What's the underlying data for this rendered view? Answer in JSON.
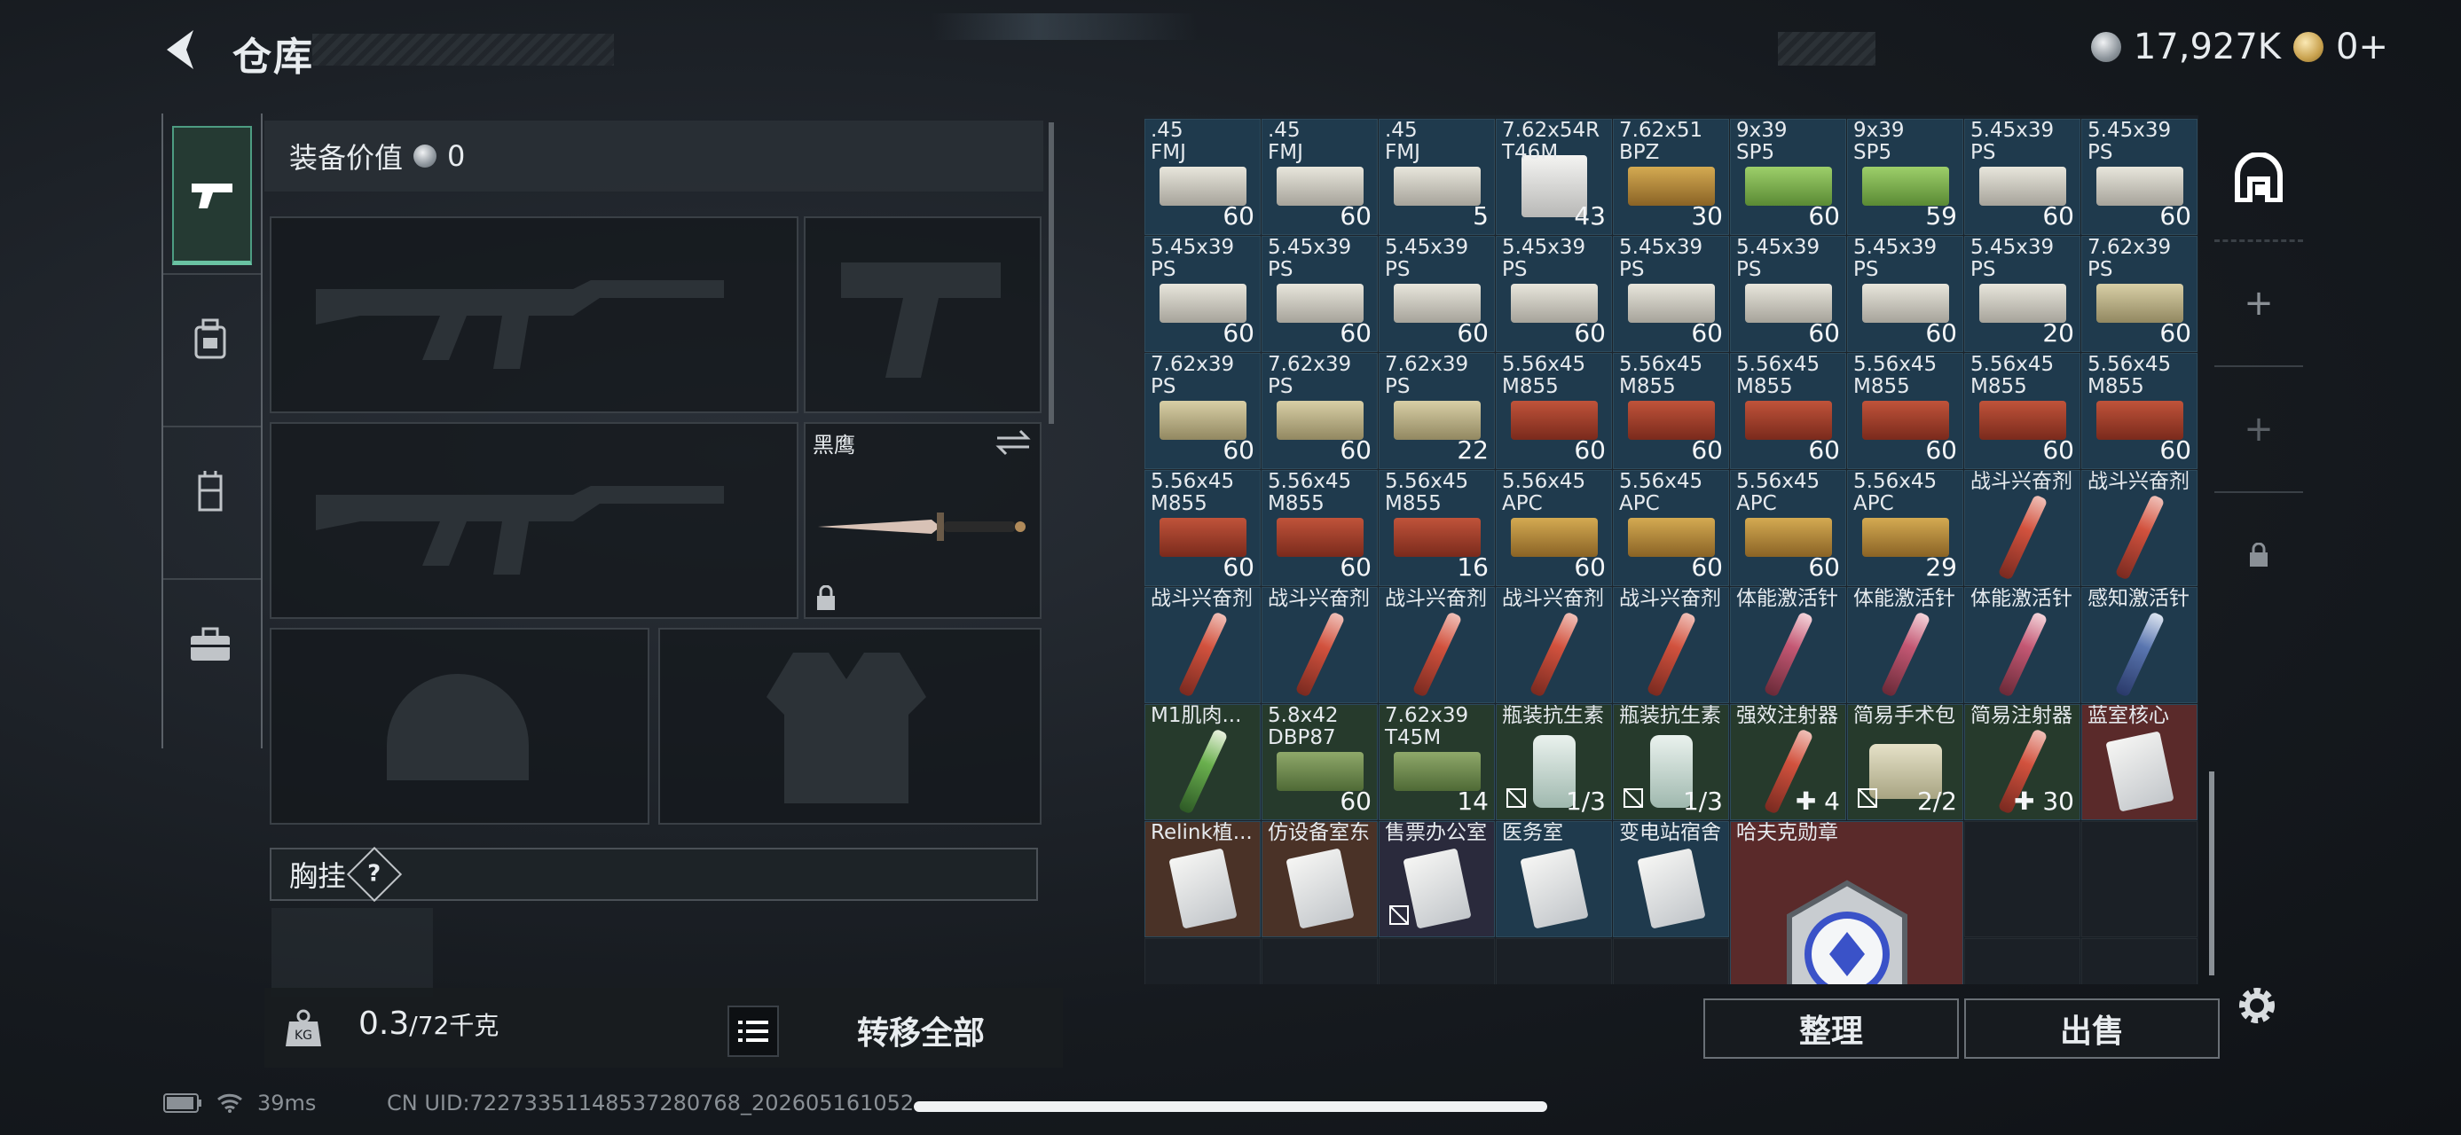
{
  "header": {
    "title": "仓库",
    "currency_silver": "17,927K",
    "currency_gold": "0+"
  },
  "equipment": {
    "value_label": "装备价值",
    "value": "0",
    "secondary_slot_label": "黑鹰",
    "chest_label": "胸挂",
    "weight_current": "0.3",
    "weight_max": "/72千克",
    "transfer_all": "转移全部"
  },
  "stash": {
    "rows": [
      [
        {
          "n": ".45\nFMJ",
          "q": "60",
          "a": "silver"
        },
        {
          "n": ".45\nFMJ",
          "q": "60",
          "a": "silver"
        },
        {
          "n": ".45\nFMJ",
          "q": "5",
          "a": "silver"
        },
        {
          "n": "7.62x54R\nT46M",
          "q": "43",
          "a": "white"
        },
        {
          "n": "7.62x51\nBPZ",
          "q": "30",
          "a": "gold"
        },
        {
          "n": "9x39\nSP5",
          "q": "60",
          "a": "grn"
        },
        {
          "n": "9x39\nSP5",
          "q": "59",
          "a": "grn"
        },
        {
          "n": "5.45x39\nPS",
          "q": "60",
          "a": "silver"
        },
        {
          "n": "5.45x39\nPS",
          "q": "60",
          "a": "silver"
        }
      ],
      [
        {
          "n": "5.45x39\nPS",
          "q": "60",
          "a": "silver"
        },
        {
          "n": "5.45x39\nPS",
          "q": "60",
          "a": "silver"
        },
        {
          "n": "5.45x39\nPS",
          "q": "60",
          "a": "silver"
        },
        {
          "n": "5.45x39\nPS",
          "q": "60",
          "a": "silver"
        },
        {
          "n": "5.45x39\nPS",
          "q": "60",
          "a": "silver"
        },
        {
          "n": "5.45x39\nPS",
          "q": "60",
          "a": "silver"
        },
        {
          "n": "5.45x39\nPS",
          "q": "60",
          "a": "silver"
        },
        {
          "n": "5.45x39\nPS",
          "q": "20",
          "a": "silver"
        },
        {
          "n": "7.62x39\nPS",
          "q": "60",
          "a": "tan"
        }
      ],
      [
        {
          "n": "7.62x39\nPS",
          "q": "60",
          "a": "tan"
        },
        {
          "n": "7.62x39\nPS",
          "q": "60",
          "a": "tan"
        },
        {
          "n": "7.62x39\nPS",
          "q": "22",
          "a": "tan"
        },
        {
          "n": "5.56x45\nM855",
          "q": "60",
          "a": "redb"
        },
        {
          "n": "5.56x45\nM855",
          "q": "60",
          "a": "redb"
        },
        {
          "n": "5.56x45\nM855",
          "q": "60",
          "a": "redb"
        },
        {
          "n": "5.56x45\nM855",
          "q": "60",
          "a": "redb"
        },
        {
          "n": "5.56x45\nM855",
          "q": "60",
          "a": "redb"
        },
        {
          "n": "5.56x45\nM855",
          "q": "60",
          "a": "redb"
        }
      ],
      [
        {
          "n": "5.56x45\nM855",
          "q": "60",
          "a": "redb"
        },
        {
          "n": "5.56x45\nM855",
          "q": "60",
          "a": "redb"
        },
        {
          "n": "5.56x45\nM855",
          "q": "16",
          "a": "redb"
        },
        {
          "n": "5.56x45\nAPC",
          "q": "60",
          "a": "gold"
        },
        {
          "n": "5.56x45\nAPC",
          "q": "60",
          "a": "gold"
        },
        {
          "n": "5.56x45\nAPC",
          "q": "60",
          "a": "gold"
        },
        {
          "n": "5.56x45\nAPC",
          "q": "29",
          "a": "gold"
        },
        {
          "n": "战斗兴奋剂",
          "q": "",
          "a": "syr-red"
        },
        {
          "n": "战斗兴奋剂",
          "q": "",
          "a": "syr-red"
        }
      ],
      [
        {
          "n": "战斗兴奋剂",
          "q": "",
          "a": "syr-red"
        },
        {
          "n": "战斗兴奋剂",
          "q": "",
          "a": "syr-red"
        },
        {
          "n": "战斗兴奋剂",
          "q": "",
          "a": "syr-red"
        },
        {
          "n": "战斗兴奋剂",
          "q": "",
          "a": "syr-red"
        },
        {
          "n": "战斗兴奋剂",
          "q": "",
          "a": "syr-red"
        },
        {
          "n": "体能激活针",
          "q": "",
          "a": "syr-pink"
        },
        {
          "n": "体能激活针",
          "q": "",
          "a": "syr-pink"
        },
        {
          "n": "体能激活针",
          "q": "",
          "a": "syr-pink"
        },
        {
          "n": "感知激活针",
          "q": "",
          "a": "syr-blue"
        }
      ],
      [
        {
          "n": "M1肌肉...",
          "q": "",
          "a": "syr-grn",
          "bg": "green"
        },
        {
          "n": "5.8x42\nDBP87",
          "q": "60",
          "a": "olive",
          "bg": "green"
        },
        {
          "n": "7.62x39\nT45M",
          "q": "14",
          "a": "olive",
          "bg": "green"
        },
        {
          "n": "瓶装抗生素",
          "q": "1/3",
          "a": "bottle",
          "bg": "green",
          "u": true
        },
        {
          "n": "瓶装抗生素",
          "q": "1/3",
          "a": "bottle",
          "bg": "green",
          "u": true
        },
        {
          "n": "强效注射器",
          "q": "✚ 4",
          "a": "syr-red",
          "bg": "green"
        },
        {
          "n": "简易手术包",
          "q": "2/2",
          "a": "pouch",
          "bg": "green",
          "u": true
        },
        {
          "n": "简易注射器",
          "q": "✚ 30",
          "a": "syr-red",
          "bg": "green"
        },
        {
          "n": "蓝室核心",
          "q": "",
          "a": "card",
          "bg": "red"
        }
      ],
      [
        {
          "n": "Relink植...",
          "q": "",
          "a": "card",
          "bg": "brown"
        },
        {
          "n": "仿设备室东",
          "q": "",
          "a": "card",
          "bg": "brown"
        },
        {
          "n": "售票办公室",
          "q": "",
          "a": "card",
          "bg": "purple",
          "u": true
        },
        {
          "n": "医务室",
          "q": "",
          "a": "card"
        },
        {
          "n": "变电站宿舍",
          "q": "",
          "a": "card"
        },
        {
          "n": "哈夫克勋章",
          "q": "",
          "a": "medal",
          "bg": "red"
        },
        {
          "n": "",
          "q": "",
          "a": "",
          "bg": "empty"
        },
        {
          "n": "",
          "q": "",
          "a": "",
          "bg": "empty"
        }
      ]
    ]
  },
  "actions": {
    "sort": "整理",
    "sell": "出售"
  },
  "status": {
    "ping": "39ms",
    "uid": "CN UID:72273351148537280768_202605161052"
  },
  "colors": {
    "accent": "#6ac3a3",
    "cell_blue": "#1f3a4d",
    "cell_green": "#263a2c",
    "cell_red": "#5a2a2a"
  }
}
